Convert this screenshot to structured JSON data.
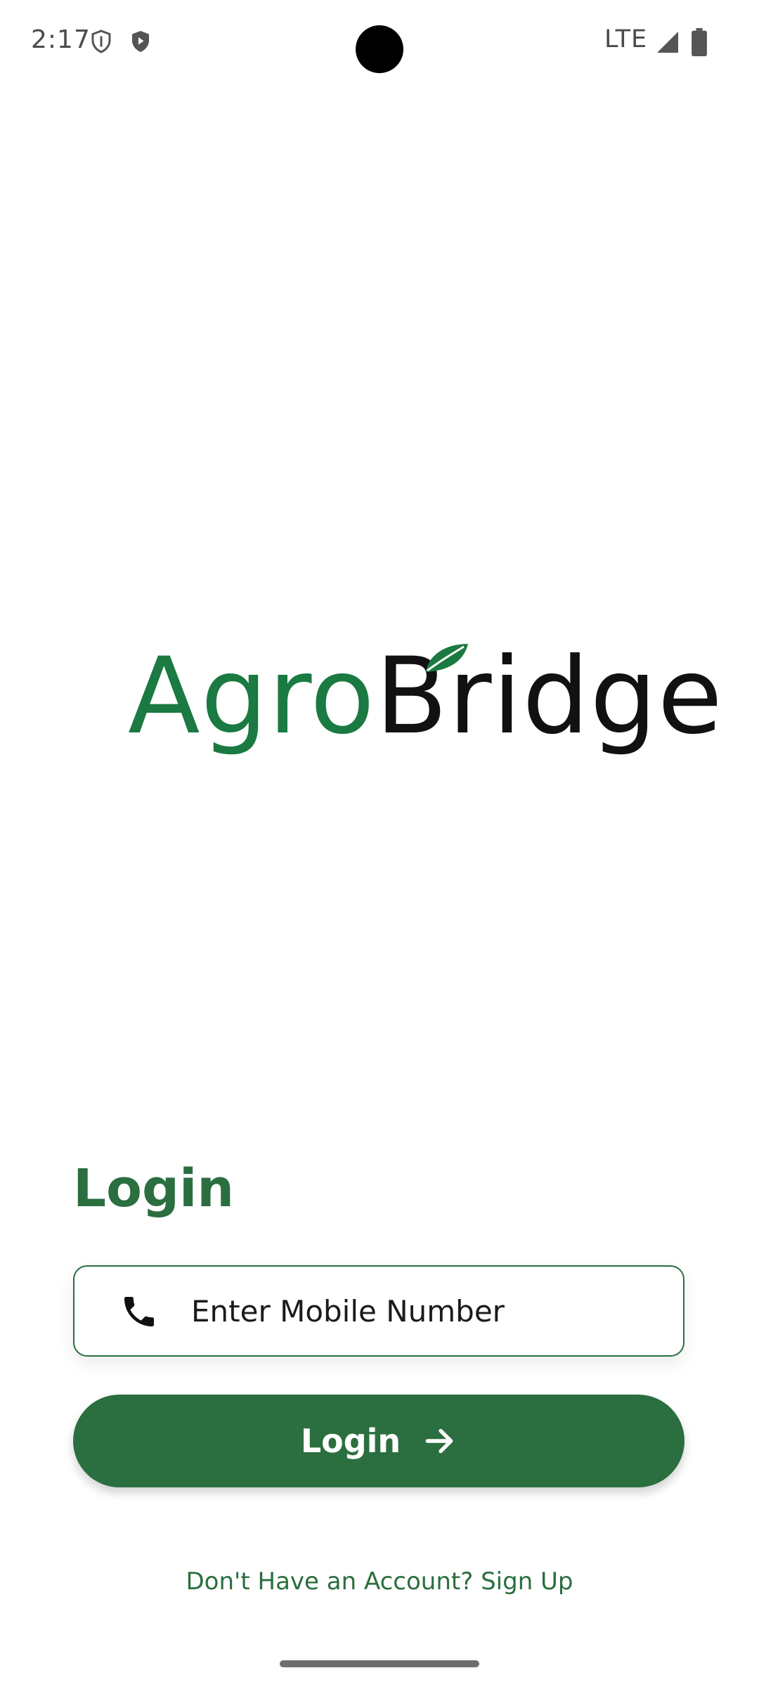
{
  "status_bar": {
    "time": "2:17",
    "network": "LTE",
    "icons": [
      "shield-icon",
      "play-shield-icon",
      "signal-icon",
      "battery-icon"
    ]
  },
  "logo": {
    "part1": "Agro",
    "part2": "Bridge",
    "colors": {
      "green": "#1a7a41",
      "dark": "#111111"
    }
  },
  "login": {
    "heading": "Login",
    "mobile_placeholder": "Enter Mobile Number",
    "button_label": "Login",
    "signup_prompt": "Don't Have an Account?",
    "signup_link": "Sign Up"
  },
  "colors": {
    "accent": "#2b6e3f",
    "background": "#ffffff"
  }
}
